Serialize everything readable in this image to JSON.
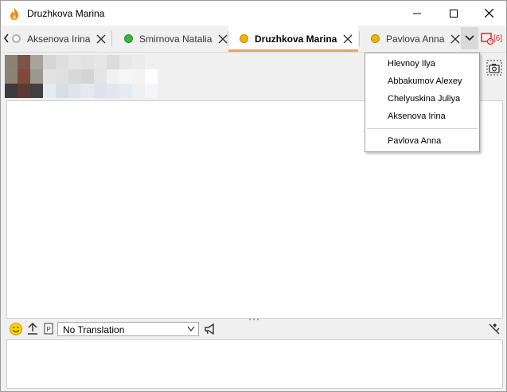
{
  "window": {
    "title": "Druzhkova Marina"
  },
  "tabs": [
    {
      "label": "Aksenova Irina",
      "status": "offline",
      "status_color": "#b0b0b0"
    },
    {
      "label": "Smirnova Natalia",
      "status": "online",
      "status_color": "#3cb43c"
    },
    {
      "label": "Druzhkova Marina",
      "status": "away",
      "status_color": "#f0b400",
      "active": true
    },
    {
      "label": "Pavlova Anna",
      "status": "away",
      "status_color": "#f0b400"
    }
  ],
  "alerts": {
    "count_label": "[6]",
    "color": "#d62828"
  },
  "overflow_menu": {
    "items": [
      "Hlevnoy Ilya",
      "Abbakumov Alexey",
      "Chelyuskina Juliya",
      "Aksenova Irina"
    ],
    "extra_item": "Pavlova Anna"
  },
  "composer": {
    "translation_selected": "No Translation"
  },
  "colors": {
    "active_tab_underline": "#f0a35e",
    "overflow_button_bg": "#dadada"
  },
  "icons": [
    "app-flame-icon",
    "minimize-icon",
    "maximize-icon",
    "close-icon",
    "chevron-left-icon",
    "chevron-down-icon",
    "alert-icon",
    "camera-icon",
    "smiley-icon",
    "upload-icon",
    "p-icon",
    "megaphone-icon",
    "translate-settings-icon"
  ]
}
